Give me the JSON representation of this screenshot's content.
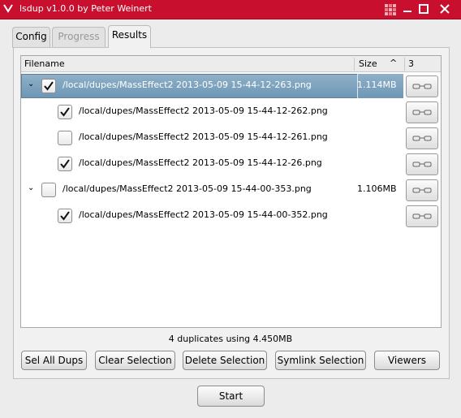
{
  "window": {
    "title": "lsdup v1.0.0 by Peter Weinert",
    "accent_color": "#c8102e"
  },
  "tabs": [
    {
      "label": "Config",
      "state": "normal"
    },
    {
      "label": "Progress",
      "state": "disabled"
    },
    {
      "label": "Results",
      "state": "active"
    }
  ],
  "table": {
    "headers": {
      "filename": "Filename",
      "size": "Size",
      "sort_indicator": "^",
      "count": "3"
    },
    "rows": [
      {
        "filename": "/local/dupes/MassEffect2 2013-05-09 15-44-12-263.png",
        "size": "1.114MB",
        "checked": true,
        "group_head": true,
        "selected": true
      },
      {
        "filename": "/local/dupes/MassEffect2 2013-05-09 15-44-12-262.png",
        "size": "",
        "checked": true,
        "group_head": false
      },
      {
        "filename": "/local/dupes/MassEffect2 2013-05-09 15-44-12-261.png",
        "size": "",
        "checked": false,
        "group_head": false
      },
      {
        "filename": "/local/dupes/MassEffect2 2013-05-09 15-44-12-26.png",
        "size": "",
        "checked": true,
        "group_head": false
      },
      {
        "filename": "/local/dupes/MassEffect2 2013-05-09 15-44-00-353.png",
        "size": "1.106MB",
        "checked": false,
        "group_head": true
      },
      {
        "filename": "/local/dupes/MassEffect2 2013-05-09 15-44-00-352.png",
        "size": "",
        "checked": true,
        "group_head": false
      }
    ]
  },
  "status": "4 duplicates using 4.450MB",
  "buttons": {
    "sel_all_dups": "Sel All Dups",
    "clear_selection": "Clear Selection",
    "delete_selection": "Delete Selection",
    "symlink_selection": "Symlink Selection",
    "viewers": "Viewers",
    "start": "Start"
  }
}
